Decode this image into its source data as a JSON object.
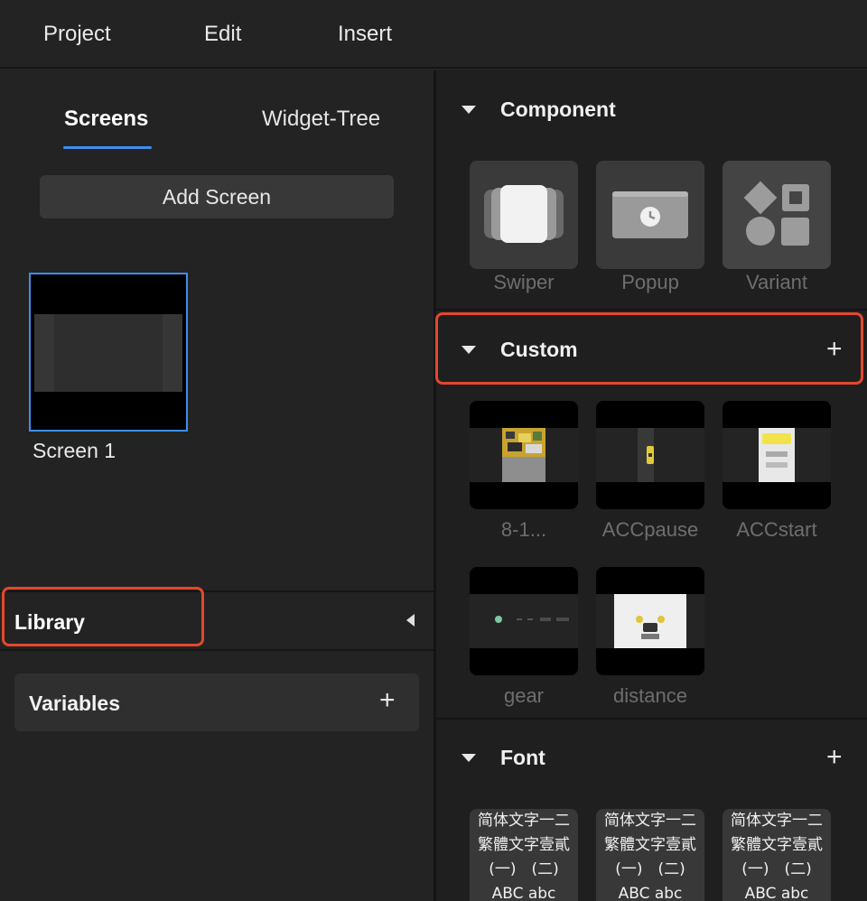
{
  "menu": {
    "project": "Project",
    "edit": "Edit",
    "insert": "Insert"
  },
  "left": {
    "tabs": {
      "screens": "Screens",
      "widget_tree": "Widget-Tree"
    },
    "add_screen": "Add Screen",
    "screens": [
      {
        "name": "Screen 1"
      }
    ],
    "library": {
      "title": "Library"
    },
    "variables": {
      "label": "Variables",
      "add": "+"
    }
  },
  "right": {
    "component": {
      "title": "Component",
      "items": [
        {
          "label": "Swiper"
        },
        {
          "label": "Popup"
        },
        {
          "label": "Variant"
        }
      ]
    },
    "custom": {
      "title": "Custom",
      "add": "+",
      "items": [
        {
          "label": "8-1..."
        },
        {
          "label": "ACCpause"
        },
        {
          "label": "ACCstart"
        },
        {
          "label": "gear"
        },
        {
          "label": "distance"
        }
      ]
    },
    "font": {
      "title": "Font",
      "add": "+",
      "sample_lines": [
        "简体文字一二",
        "繁體文字壹貳",
        "(一)　(二)",
        "ABC abc"
      ]
    }
  },
  "colors": {
    "accent": "#3f8ef0",
    "highlight": "#e5472d",
    "panel": "#232323"
  }
}
